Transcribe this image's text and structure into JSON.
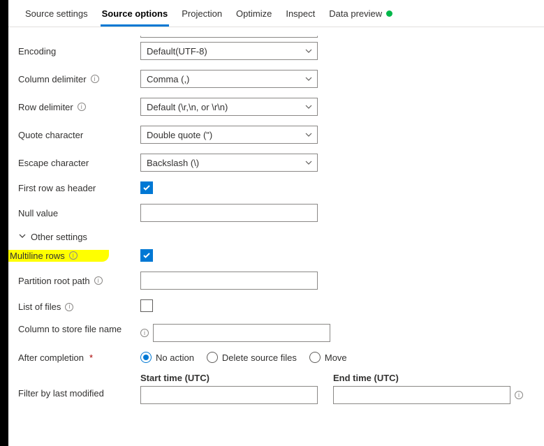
{
  "tabs": {
    "source_settings": "Source settings",
    "source_options": "Source options",
    "projection": "Projection",
    "optimize": "Optimize",
    "inspect": "Inspect",
    "data_preview": "Data preview"
  },
  "labels": {
    "encoding": "Encoding",
    "column_delimiter": "Column delimiter",
    "row_delimiter": "Row delimiter",
    "quote_character": "Quote character",
    "escape_character": "Escape character",
    "first_row_header": "First row as header",
    "null_value": "Null value",
    "other_settings": "Other settings",
    "multiline_rows": "Multiline rows",
    "partition_root_path": "Partition root path",
    "list_of_files": "List of files",
    "column_store_file_name": "Column to store file name",
    "after_completion": "After completion",
    "filter_by_last_modified": "Filter by last modified",
    "start_time": "Start time (UTC)",
    "end_time": "End time (UTC)"
  },
  "values": {
    "encoding": "Default(UTF-8)",
    "column_delimiter": "Comma (,)",
    "row_delimiter": "Default (\\r,\\n, or \\r\\n)",
    "quote_character": "Double quote (\")",
    "escape_character": "Backslash (\\)",
    "first_row_header_checked": true,
    "null_value": "",
    "multiline_rows_checked": true,
    "partition_root_path": "",
    "list_of_files_checked": false,
    "column_store_file_name": "",
    "after_completion_selected": "no_action",
    "start_time": "",
    "end_time": ""
  },
  "radios": {
    "no_action": "No action",
    "delete_source": "Delete source files",
    "move": "Move"
  },
  "symbols": {
    "required": "*",
    "info": "i"
  }
}
